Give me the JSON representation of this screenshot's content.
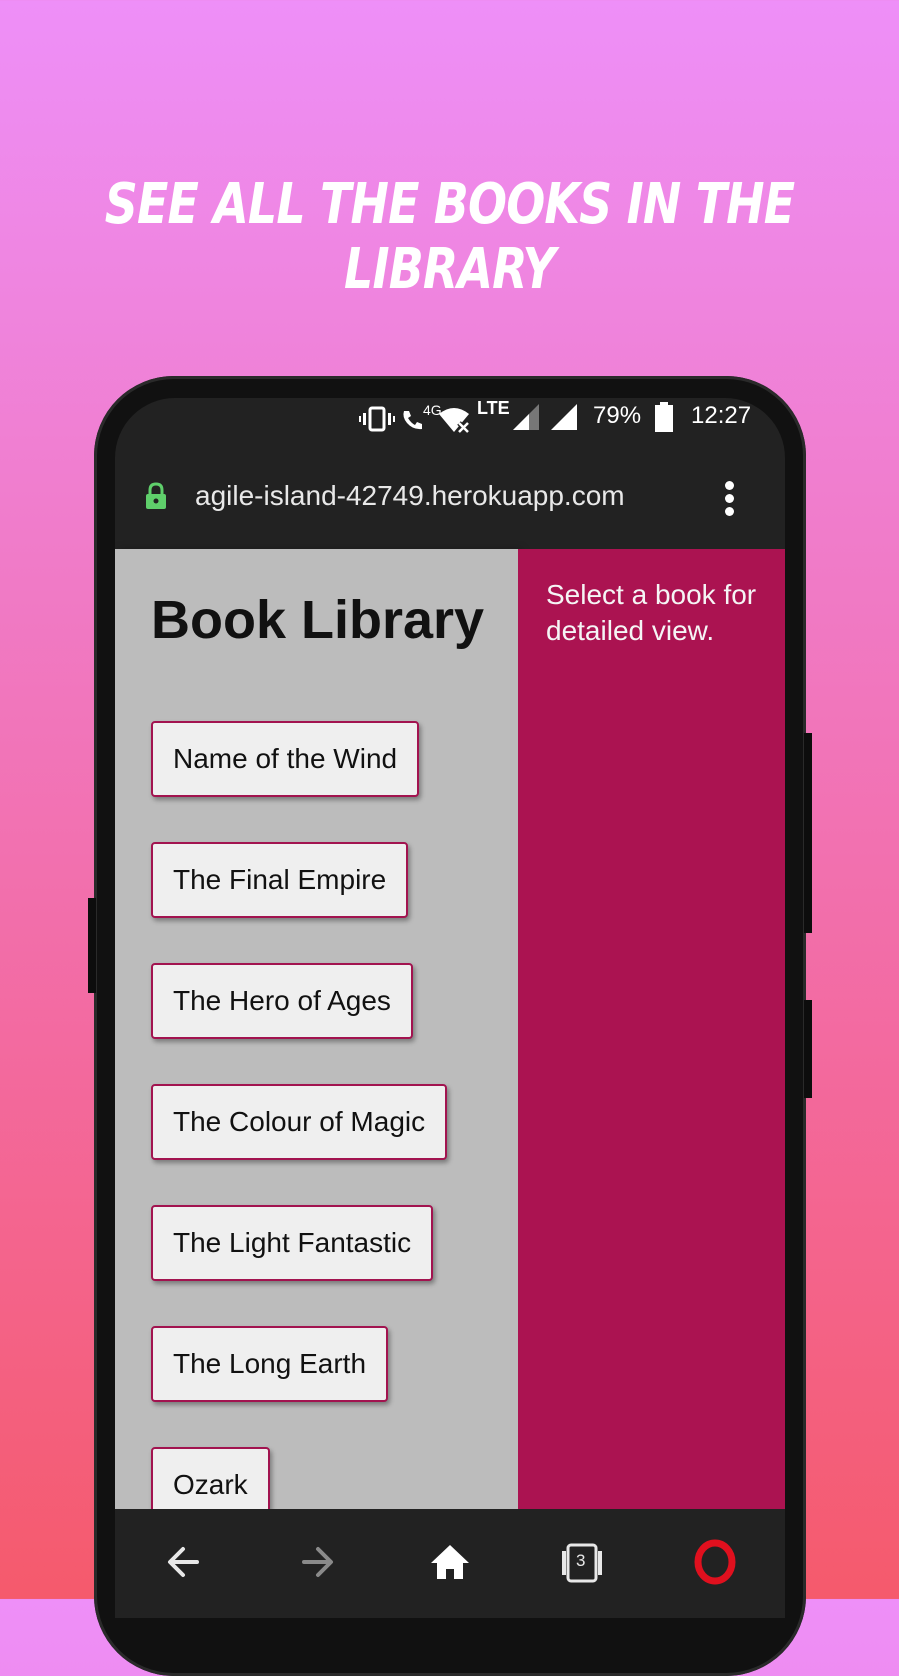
{
  "headline": "SEE ALL THE BOOKS IN THE LIBRARY",
  "status_bar": {
    "network_4g": "4G",
    "network_lte": "LTE",
    "battery": "79%",
    "time": "12:27"
  },
  "browser": {
    "url": "agile-island-42749.herokuapp.com",
    "tab_count": "3"
  },
  "page": {
    "title": "Book Library",
    "detail_placeholder": "Select a book for detailed view.",
    "books": [
      "Name of the Wind",
      "The Final Empire",
      "The Hero of Ages",
      "The Colour of Magic",
      "The Light Fantastic",
      "The Long Earth",
      "Ozark"
    ]
  },
  "colors": {
    "accent": "#ab1351",
    "left_pane": "#bcbcbc",
    "browser_chrome": "#222222",
    "lock_green": "#5fcf6b",
    "opera_red": "#e0101e"
  },
  "icons": {
    "lock": "lock-icon",
    "menu": "more-vertical-icon",
    "back": "arrow-left-icon",
    "forward": "arrow-right-icon",
    "home": "home-icon",
    "tabs": "tabs-icon",
    "opera": "opera-logo-icon",
    "add": "plus-icon"
  }
}
